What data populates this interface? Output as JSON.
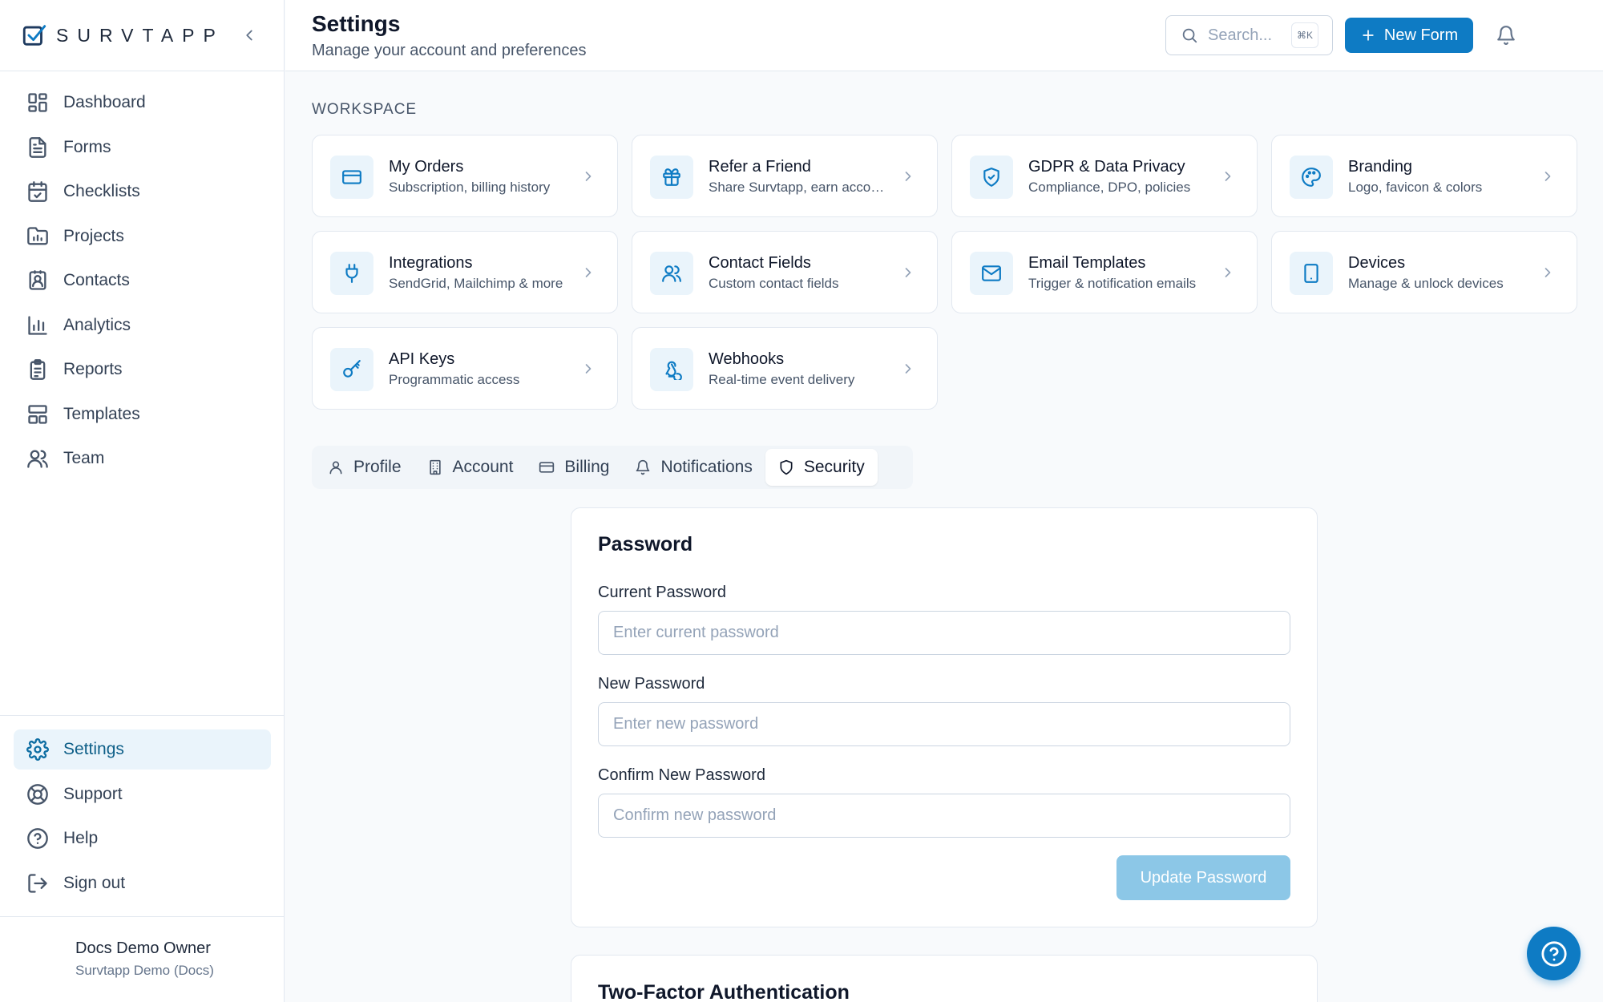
{
  "brand": {
    "name": "SURVTAPP",
    "logo_icon": "checkbox-logo-icon"
  },
  "sidebar": {
    "items": [
      {
        "label": "Dashboard",
        "icon": "dashboard-icon"
      },
      {
        "label": "Forms",
        "icon": "file-text-icon"
      },
      {
        "label": "Checklists",
        "icon": "calendar-check-icon"
      },
      {
        "label": "Projects",
        "icon": "folder-chart-icon"
      },
      {
        "label": "Contacts",
        "icon": "contact-card-icon"
      },
      {
        "label": "Analytics",
        "icon": "bar-chart-icon"
      },
      {
        "label": "Reports",
        "icon": "clipboard-icon"
      },
      {
        "label": "Templates",
        "icon": "layout-icon"
      },
      {
        "label": "Team",
        "icon": "users-icon"
      }
    ],
    "bottom_items": [
      {
        "label": "Settings",
        "icon": "gear-icon",
        "active": true
      },
      {
        "label": "Support",
        "icon": "life-buoy-icon"
      },
      {
        "label": "Help",
        "icon": "help-circle-icon"
      },
      {
        "label": "Sign out",
        "icon": "sign-out-icon"
      }
    ],
    "user": {
      "name": "Docs Demo Owner",
      "org": "Survtapp Demo (Docs)"
    }
  },
  "header": {
    "title": "Settings",
    "subtitle": "Manage your account and preferences",
    "search_placeholder": "Search...",
    "search_shortcut": "⌘K",
    "new_form_label": "New Form"
  },
  "workspace": {
    "label": "WORKSPACE",
    "cards": [
      {
        "title": "My Orders",
        "desc": "Subscription, billing history",
        "icon": "credit-card-icon"
      },
      {
        "title": "Refer a Friend",
        "desc": "Share Survtapp, earn account credit",
        "icon": "gift-icon"
      },
      {
        "title": "GDPR & Data Privacy",
        "desc": "Compliance, DPO, policies",
        "icon": "shield-check-icon"
      },
      {
        "title": "Branding",
        "desc": "Logo, favicon & colors",
        "icon": "palette-icon"
      },
      {
        "title": "Integrations",
        "desc": "SendGrid, Mailchimp & more",
        "icon": "plug-icon"
      },
      {
        "title": "Contact Fields",
        "desc": "Custom contact fields",
        "icon": "users-icon"
      },
      {
        "title": "Email Templates",
        "desc": "Trigger & notification emails",
        "icon": "mail-icon"
      },
      {
        "title": "Devices",
        "desc": "Manage & unlock devices",
        "icon": "tablet-icon"
      },
      {
        "title": "API Keys",
        "desc": "Programmatic access",
        "icon": "key-icon"
      },
      {
        "title": "Webhooks",
        "desc": "Real-time event delivery",
        "icon": "webhook-icon"
      }
    ]
  },
  "tabs": [
    {
      "label": "Profile",
      "icon": "user-icon"
    },
    {
      "label": "Account",
      "icon": "building-icon"
    },
    {
      "label": "Billing",
      "icon": "credit-card-icon"
    },
    {
      "label": "Notifications",
      "icon": "bell-icon"
    },
    {
      "label": "Security",
      "icon": "shield-icon",
      "active": true
    }
  ],
  "password": {
    "title": "Password",
    "current_label": "Current Password",
    "current_placeholder": "Enter current password",
    "new_label": "New Password",
    "new_placeholder": "Enter new password",
    "confirm_label": "Confirm New Password",
    "confirm_placeholder": "Confirm new password",
    "submit_label": "Update Password"
  },
  "two_factor": {
    "title": "Two-Factor Authentication"
  },
  "colors": {
    "accent": "#0e7bc4",
    "accent_light": "#eaf4fb",
    "disabled_button": "#8cc7e7"
  }
}
